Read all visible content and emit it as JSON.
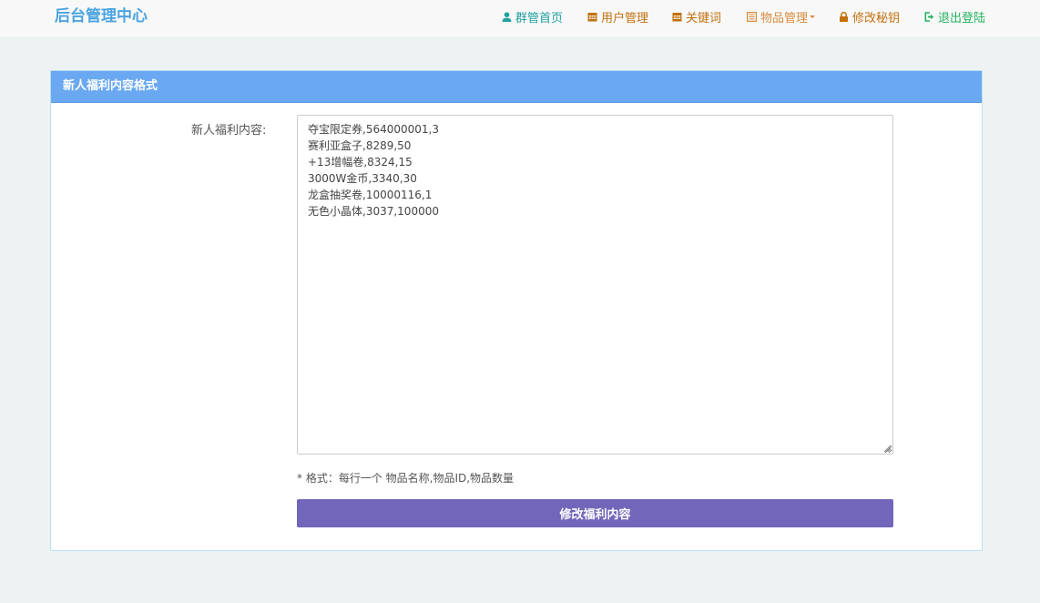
{
  "app": {
    "brand": "后台管理中心"
  },
  "nav": {
    "items": [
      {
        "label": "群管首页",
        "icon": "user-icon",
        "color": "#21a0a0"
      },
      {
        "label": "用户管理",
        "icon": "calendar-icon",
        "color": "#c2700c"
      },
      {
        "label": "关键词",
        "icon": "calendar-icon",
        "color": "#c2700c"
      },
      {
        "label": "物品管理",
        "icon": "list-icon",
        "color": "#d88a3b",
        "dropdown": true
      },
      {
        "label": "修改秘钥",
        "icon": "lock-icon",
        "color": "#c2700c"
      },
      {
        "label": "退出登陆",
        "icon": "logout-icon",
        "color": "#22b35e"
      }
    ]
  },
  "panel": {
    "title": "新人福利内容格式",
    "field_label": "新人福利内容:",
    "textarea_value": "夺宝限定券,564000001,3\n赛利亚盒子,8289,50\n+13增幅卷,8324,15\n3000W金币,3340,30\n龙盒抽奖卷,10000116,1\n无色小晶体,3037,100000",
    "help_text": "* 格式：每行一个 物品名称,物品ID,物品数量",
    "submit_label": "修改福利内容"
  },
  "colors": {
    "brand": "#4aa3df",
    "panel_heading": "#6aa9f2",
    "button": "#7266ba",
    "page_bg": "#eef2f3"
  }
}
